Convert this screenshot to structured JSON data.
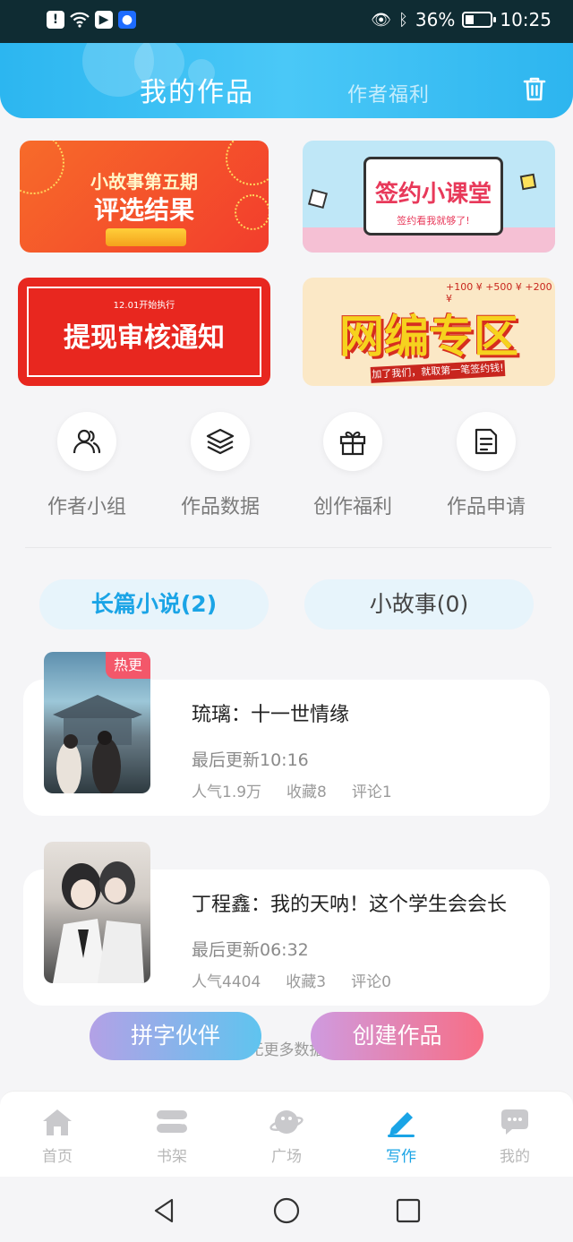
{
  "status_bar": {
    "icons": [
      "alert-icon",
      "wifi-icon",
      "play-icon",
      "bulb-icon"
    ],
    "battery": "36%",
    "time": "10:25",
    "battery_level": 0.36
  },
  "header": {
    "title": "我的作品",
    "tab_secondary": "作者福利",
    "trash_icon": "trash-icon",
    "gradient_color": "#2cb6f0"
  },
  "banners": [
    {
      "line1": "小故事第五期",
      "line2": "评选结果"
    },
    {
      "line1": "签约小课堂",
      "line2": "签约看我就够了!"
    },
    {
      "line1": "12.01开始执行",
      "line2": "提现审核通知"
    },
    {
      "line1": "网编专区",
      "line2": "加了我们，就取第一笔签约钱!",
      "nums": "+100 ¥  +500 ¥  +200 ¥"
    }
  ],
  "quick_actions": [
    {
      "label": "作者小组",
      "icon": "people-icon"
    },
    {
      "label": "作品数据",
      "icon": "layers-icon"
    },
    {
      "label": "创作福利",
      "icon": "gift-icon"
    },
    {
      "label": "作品申请",
      "icon": "document-icon"
    }
  ],
  "tabs": [
    {
      "label": "长篇小说(2)",
      "active": true
    },
    {
      "label": "小故事(0)",
      "active": false
    }
  ],
  "works": [
    {
      "badge": "热更",
      "title": "琉璃：十一世情缘",
      "updated": "最后更新10:16",
      "popularity": "人气1.9万",
      "favorites": "收藏8",
      "comments": "评论1"
    },
    {
      "badge": "",
      "title": "丁程鑫：我的天呐！这个学生会会长",
      "updated": "最后更新06:32",
      "popularity": "人气4404",
      "favorites": "收藏3",
      "comments": "评论0"
    }
  ],
  "load_more": "无更多数据",
  "fab": {
    "partner": "拼字伙伴",
    "create": "创建作品"
  },
  "bottom_nav": [
    {
      "label": "首页",
      "icon": "home-icon"
    },
    {
      "label": "书架",
      "icon": "bookshelf-icon"
    },
    {
      "label": "广场",
      "icon": "planet-icon"
    },
    {
      "label": "写作",
      "icon": "pen-icon",
      "active": true
    },
    {
      "label": "我的",
      "icon": "chat-icon"
    }
  ],
  "colors": {
    "accent": "#1aa4e6",
    "hot_badge": "#f3576a"
  }
}
